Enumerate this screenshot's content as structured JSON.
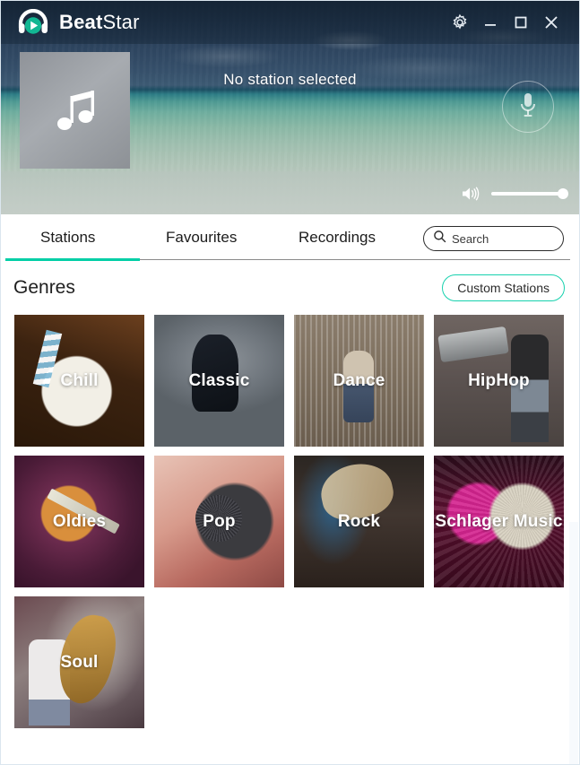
{
  "window": {
    "title_bold": "Beat",
    "title_light": "Star",
    "logo_icon": "headphones-play-logo",
    "controls": [
      {
        "name": "settings",
        "icon": "gear-icon",
        "label": "Settings"
      },
      {
        "name": "minimize",
        "icon": "minimize-icon",
        "label": "Minimize"
      },
      {
        "name": "maximize",
        "icon": "maximize-icon",
        "label": "Maximize"
      },
      {
        "name": "close",
        "icon": "close-icon",
        "label": "Close"
      }
    ]
  },
  "player": {
    "album_art_icon": "music-note-icon",
    "now_playing": "No station selected",
    "mic_icon": "microphone-icon",
    "volume_icon": "speaker-volume-icon",
    "volume_percent": 100
  },
  "tabs": [
    {
      "label": "Stations",
      "active": true
    },
    {
      "label": "Favourites",
      "active": false
    },
    {
      "label": "Recordings",
      "active": false
    }
  ],
  "search": {
    "icon": "search-icon",
    "placeholder": "Search",
    "value": ""
  },
  "content": {
    "heading": "Genres",
    "custom_stations_label": "Custom Stations",
    "genres": [
      {
        "label": "Chill",
        "art": "art-chill"
      },
      {
        "label": "Classic",
        "art": "art-classic"
      },
      {
        "label": "Dance",
        "art": "art-dance"
      },
      {
        "label": "HipHop",
        "art": "art-hiphop"
      },
      {
        "label": "Oldies",
        "art": "art-oldies"
      },
      {
        "label": "Pop",
        "art": "art-pop"
      },
      {
        "label": "Rock",
        "art": "art-rock"
      },
      {
        "label": "Schlager Music",
        "art": "art-schlager"
      },
      {
        "label": "Soul",
        "art": "art-soul"
      }
    ]
  },
  "colors": {
    "accent_teal": "#00cfa6",
    "accent_teal_outline": "#17d1ae",
    "titlebar_dark": "#16293c",
    "text_dark": "#1c1c1c"
  }
}
